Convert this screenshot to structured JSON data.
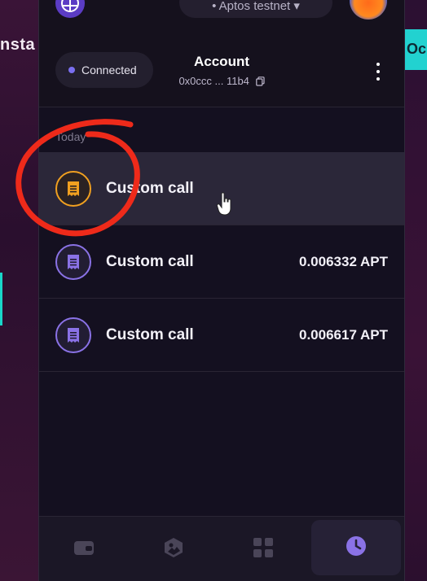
{
  "background": {
    "left_text": "nsta",
    "right_text": "Oc"
  },
  "header": {
    "network": "• Aptos testnet ▾"
  },
  "account": {
    "status": "Connected",
    "title": "Account",
    "address": "0x0ccc ... 11b4"
  },
  "activity": {
    "section_label": "Today",
    "transactions": [
      {
        "label": "Custom call",
        "amount": "",
        "status_color": "#f0a020"
      },
      {
        "label": "Custom call",
        "amount": "0.006332 APT",
        "status_color": "#8a72e6"
      },
      {
        "label": "Custom call",
        "amount": "0.006617 APT",
        "status_color": "#8a72e6"
      }
    ]
  },
  "bottom_nav": {
    "items": [
      {
        "icon": "wallet-icon"
      },
      {
        "icon": "nft-gallery-icon"
      },
      {
        "icon": "apps-grid-icon"
      },
      {
        "icon": "clock-icon"
      }
    ],
    "active": "clock-icon"
  },
  "colors": {
    "accent_purple": "#8a72e6",
    "pending_orange": "#f0a020",
    "annotation_red": "#ee2a1a"
  }
}
